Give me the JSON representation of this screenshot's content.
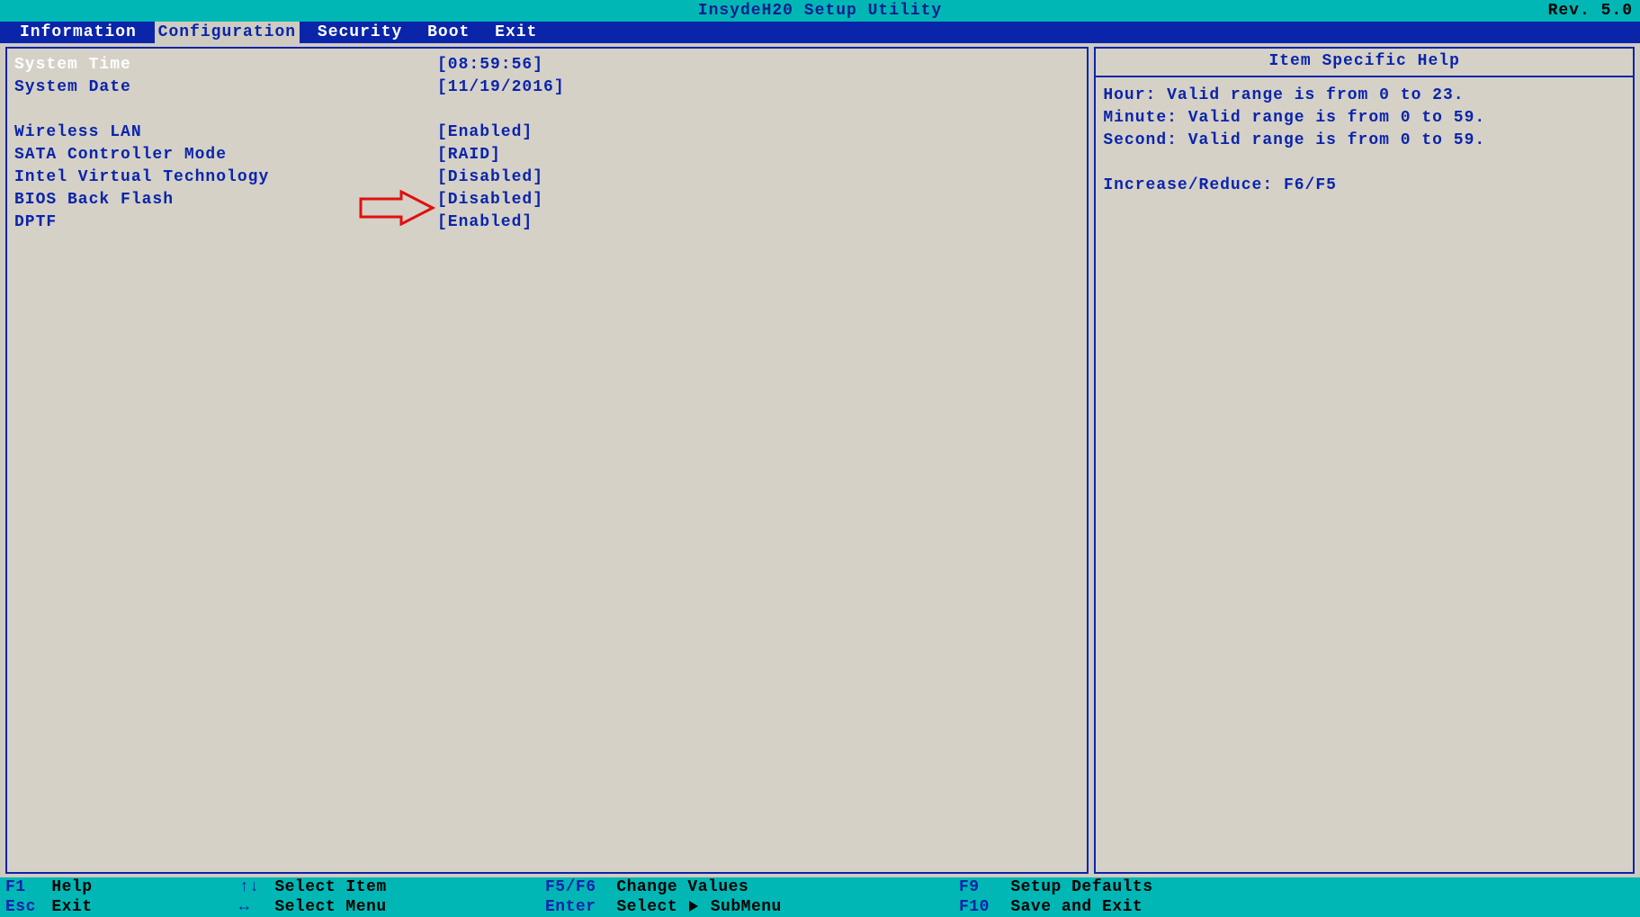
{
  "title": "InsydeH20 Setup Utility",
  "revision": "Rev. 5.0",
  "menu": {
    "items": [
      "Information",
      "Configuration",
      "Security",
      "Boot",
      "Exit"
    ],
    "active_index": 1
  },
  "settings": [
    {
      "label": "System Time",
      "value": "[08:59:56]",
      "selected": true
    },
    {
      "label": "System Date",
      "value": "[11/19/2016]"
    },
    {
      "spacer": true
    },
    {
      "label": "Wireless LAN",
      "value": "[Enabled]"
    },
    {
      "label": "SATA Controller Mode",
      "value": "[RAID]"
    },
    {
      "label": "Intel Virtual Technology",
      "value": "[Disabled]"
    },
    {
      "label": "BIOS Back Flash",
      "value": "[Disabled]"
    },
    {
      "label": "DPTF",
      "value": "[Enabled]"
    }
  ],
  "help": {
    "title": "Item Specific Help",
    "lines": [
      "Hour: Valid range is from 0 to 23.",
      "Minute: Valid range is from 0 to 59.",
      "Second: Valid range is from 0 to 59.",
      "",
      "Increase/Reduce: F6/F5"
    ]
  },
  "footer": {
    "col1": [
      {
        "key": "F1",
        "action": "Help"
      },
      {
        "key": "Esc",
        "action": "Exit"
      }
    ],
    "col2": [
      {
        "glyph": "↑↓",
        "action": "Select Item"
      },
      {
        "glyph": "↔",
        "action": "Select Menu"
      }
    ],
    "col3": [
      {
        "key": "F5/F6",
        "action": "Change Values"
      },
      {
        "key": "Enter",
        "action": "Select ▶ SubMenu"
      }
    ],
    "col4": [
      {
        "key": "F9",
        "action": "Setup Defaults"
      },
      {
        "key": "F10",
        "action": "Save and Exit"
      }
    ]
  },
  "annotation": {
    "arrow_color": "#e01010"
  }
}
